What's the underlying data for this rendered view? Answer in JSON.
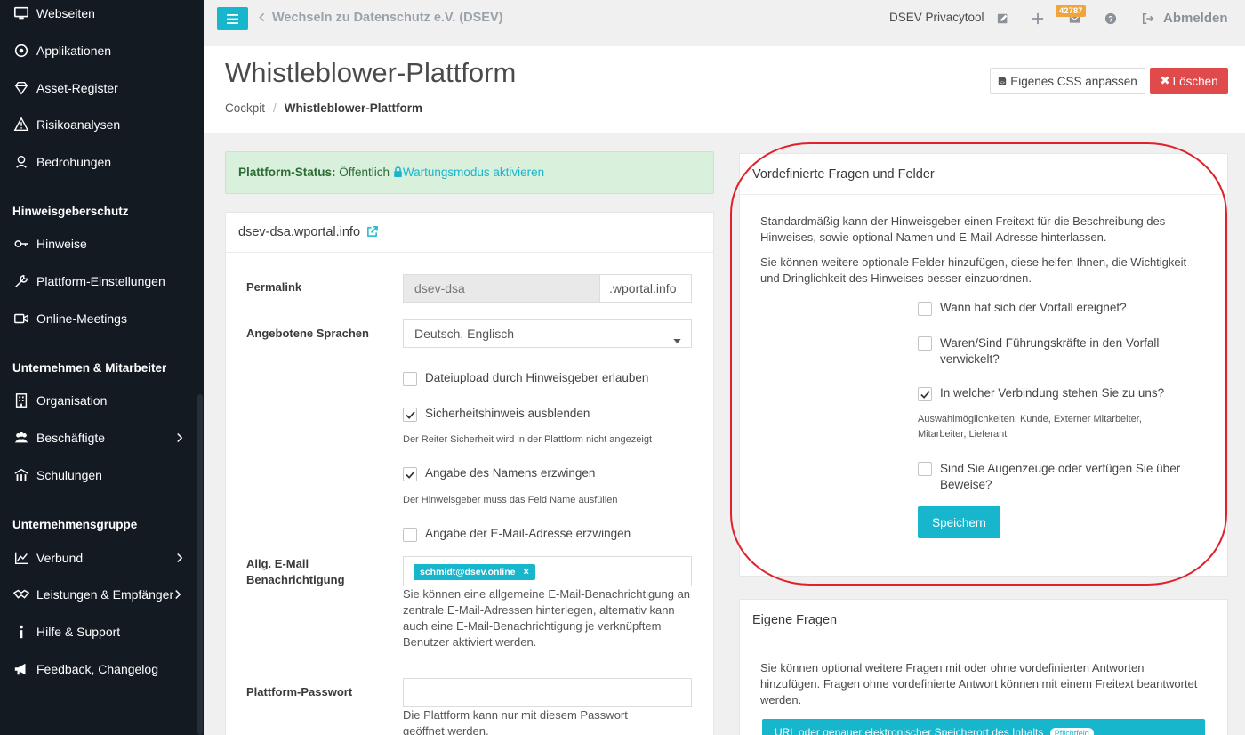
{
  "sidebar": {
    "items": [
      {
        "label": "Webseiten",
        "icon": "monitor-icon"
      },
      {
        "label": "Applikationen",
        "icon": "app-icon"
      },
      {
        "label": "Asset-Register",
        "icon": "diamond-icon"
      },
      {
        "label": "Risikoanalysen",
        "icon": "warning-icon"
      },
      {
        "label": "Bedrohungen",
        "icon": "threat-icon"
      },
      {
        "label": "Hinweise",
        "icon": "key-icon"
      },
      {
        "label": "Plattform-Einstellungen",
        "icon": "wrench-icon"
      },
      {
        "label": "Online-Meetings",
        "icon": "video-icon"
      },
      {
        "label": "Organisation",
        "icon": "building-icon"
      },
      {
        "label": "Beschäftigte",
        "icon": "users-icon"
      },
      {
        "label": "Schulungen",
        "icon": "training-icon"
      },
      {
        "label": "Verbund",
        "icon": "chart-icon"
      },
      {
        "label": "Leistungen & Empfänger",
        "icon": "handshake-icon"
      },
      {
        "label": "Hilfe & Support",
        "icon": "info-icon"
      },
      {
        "label": "Feedback, Changelog",
        "icon": "megaphone-icon"
      }
    ],
    "sections": {
      "whistle": "Hinweisgeberschutz",
      "company": "Unternehmen & Mitarbeiter",
      "group": "Unternehmensgruppe"
    }
  },
  "topbar": {
    "back_label": "Wechseln zu Datenschutz e.V. (DSEV)",
    "tool_name": "DSEV Privacytool",
    "badge_count": "42787",
    "logout_label": "Abmelden"
  },
  "header": {
    "title": "Whistleblower-Plattform",
    "breadcrumb_root": "Cockpit",
    "breadcrumb_current": "Whistleblower-Plattform",
    "css_button": "Eigenes CSS anpassen",
    "delete_button": "Löschen"
  },
  "status": {
    "label": "Plattform-Status:",
    "value": "Öffentlich",
    "link": "Wartungsmodus aktivieren"
  },
  "platform": {
    "domain": "dsev-dsa.wportal.info",
    "permalink_label": "Permalink",
    "permalink_value": "dsev-dsa",
    "permalink_suffix": ".wportal.info",
    "languages_label": "Angebotene Sprachen",
    "languages_value": "Deutsch, Englisch",
    "cb_upload": "Dateiupload durch Hinweisgeber erlauben",
    "cb_security": "Sicherheitshinweis ausblenden",
    "cb_security_help": "Der Reiter Sicherheit wird in der Plattform nicht angezeigt",
    "cb_name": "Angabe des Namens erzwingen",
    "cb_name_help": "Der Hinweisgeber muss das Feld Name ausfüllen",
    "cb_email": "Angabe der E-Mail-Adresse erzwingen",
    "notify_label_1": "Allg. E-Mail",
    "notify_label_2": "Benachrichtigung",
    "notify_tag": "schmidt@dsev.online",
    "notify_help": "Sie können eine allgemeine E-Mail-Benachrichtigung an zentrale E-Mail-Adressen hinterlegen, alternativ kann auch eine E-Mail-Benachrichtigung je verknüpftem Benutzer aktiviert werden.",
    "password_label": "Plattform-Passwort",
    "password_value": "",
    "password_help": "Die Plattform kann nur mit diesem Passwort geöffnet werden."
  },
  "predefined": {
    "title": "Vordefinierte Fragen und Felder",
    "intro_1": "Standardmäßig kann der Hinweisgeber einen Freitext für die Beschreibung des Hinweises, sowie optional Namen und E-Mail-Adresse hinterlassen.",
    "intro_2": "Sie können weitere optionale Felder hinzufügen, diese helfen Ihnen, die Wichtigkeit und Dringlichkeit des Hinweises besser einzuordnen.",
    "q1": "Wann hat sich der Vorfall ereignet?",
    "q2": "Waren/Sind Führungskräfte in den Vorfall verwickelt?",
    "q3": "In welcher Verbindung stehen Sie zu uns?",
    "q3_help": "Auswahlmöglichkeiten: Kunde, Externer Mitarbeiter, Mitarbeiter, Lieferant",
    "q4": "Sind Sie Augenzeuge oder verfügen Sie über Beweise?",
    "save_button": "Speichern"
  },
  "own_questions": {
    "title": "Eigene Fragen",
    "intro": "Sie können optional weitere Fragen mit oder ohne vordefinierten Antworten hinzufügen. Fragen ohne vordefinierte Antwort können mit einem Freitext beantwortet werden.",
    "item_text": "URL oder genauer elektronischer Speicherort des Inhalts",
    "item_badge": "Pflichtfeld"
  },
  "colors": {
    "accent": "#17b6cc",
    "danger": "#e04a4a",
    "sidebar_bg": "#131a22",
    "success_bg": "#d9f0dd",
    "highlight": "#e0202a"
  }
}
